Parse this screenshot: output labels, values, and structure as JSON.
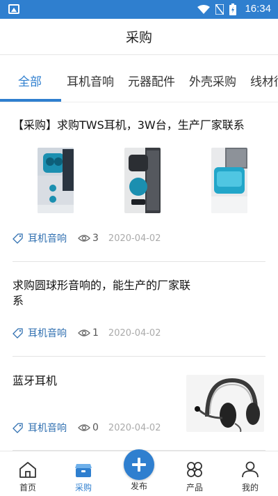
{
  "status_bar": {
    "time": "16:34"
  },
  "header": {
    "title": "采购"
  },
  "tabs": [
    {
      "label": "全部",
      "active": true
    },
    {
      "label": "耳机音响"
    },
    {
      "label": "元器配件"
    },
    {
      "label": "外壳采购"
    },
    {
      "label": "线材衍"
    }
  ],
  "posts": [
    {
      "title": "【采购】求购TWS耳机，3W台，生产厂家联系",
      "tag": "耳机音响",
      "views": "3",
      "date": "2020-04-02",
      "images": [
        "blue-earbuds-photo",
        "black-speaker-photo",
        "blue-case-photo"
      ]
    },
    {
      "title": "求购圆球形音响的，能生产的厂家联系",
      "tag": "耳机音响",
      "views": "1",
      "date": "2020-04-02"
    },
    {
      "title": "蓝牙耳机",
      "tag": "耳机音响",
      "views": "0",
      "date": "2020-04-02",
      "images": [
        "headset-photo"
      ]
    }
  ],
  "bottom_nav": [
    {
      "label": "首页",
      "icon": "home-icon"
    },
    {
      "label": "采购",
      "icon": "box-icon",
      "active": true
    },
    {
      "label": "发布",
      "icon": "plus-icon"
    },
    {
      "label": "产品",
      "icon": "flower-icon"
    },
    {
      "label": "我的",
      "icon": "user-icon"
    }
  ],
  "colors": {
    "accent": "#2f7fcf",
    "tag": "#2f6fb0",
    "date": "#aaaaaa"
  }
}
